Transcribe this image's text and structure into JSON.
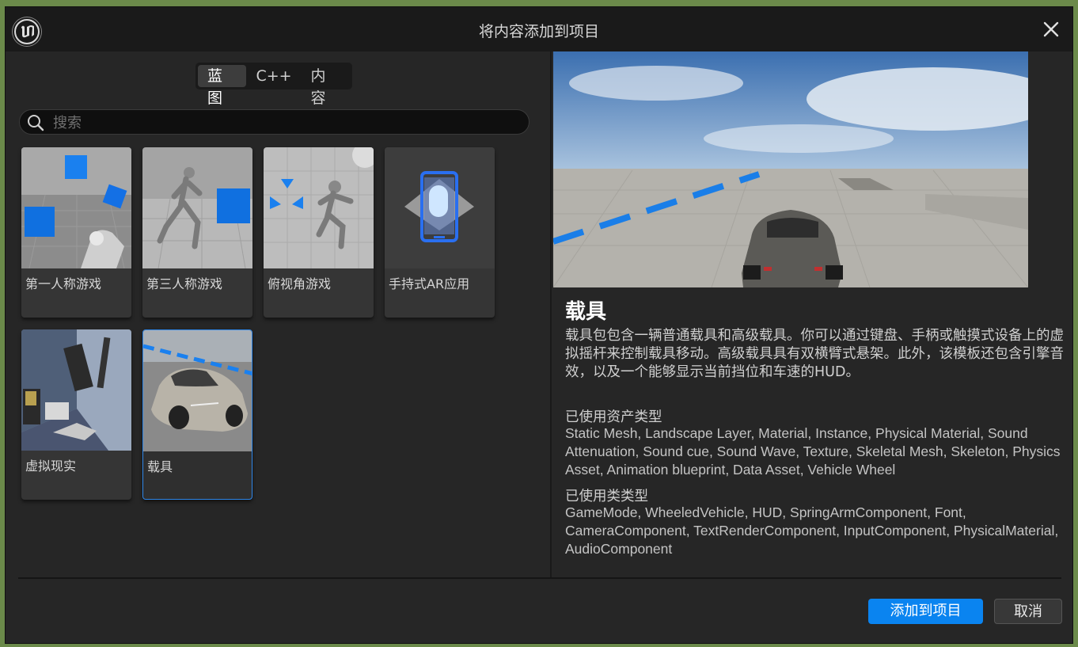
{
  "window": {
    "title": "将内容添加到项目"
  },
  "tabs": [
    {
      "label": "蓝图",
      "active": true
    },
    {
      "label": "C++",
      "active": false
    },
    {
      "label": "内容",
      "active": false
    }
  ],
  "search": {
    "placeholder": "搜索",
    "value": ""
  },
  "templates": [
    {
      "label": "第一人称游戏",
      "thumb": "first-person-thumbnail"
    },
    {
      "label": "第三人称游戏",
      "thumb": "third-person-thumbnail"
    },
    {
      "label": "俯视角游戏",
      "thumb": "top-down-thumbnail"
    },
    {
      "label": "手持式AR应用",
      "thumb": "handheld-ar-thumbnail"
    },
    {
      "label": "虚拟现实",
      "thumb": "virtual-reality-thumbnail"
    },
    {
      "label": "载具",
      "thumb": "vehicle-thumbnail",
      "selected": true
    }
  ],
  "details": {
    "title": "载具",
    "description": "载具包包含一辆普通载具和高级载具。你可以通过键盘、手柄或触摸式设备上的虚拟摇杆来控制载具移动。高级载具具有双横臂式悬架。此外，该模板还包含引擎音效，以及一个能够显示当前挡位和车速的HUD。",
    "assets_heading": "已使用资产类型",
    "assets": "Static Mesh, Landscape Layer, Material, Instance, Physical Material, Sound Attenuation, Sound cue, Sound Wave, Texture, Skeletal Mesh, Skeleton, Physics Asset, Animation blueprint, Data Asset, Vehicle Wheel",
    "classes_heading": "已使用类类型",
    "classes": "GameMode, WheeledVehicle, HUD, SpringArmComponent, Font, CameraComponent, TextRenderComponent, InputComponent, PhysicalMaterial, AudioComponent"
  },
  "buttons": {
    "add": "添加到项目",
    "cancel": "取消"
  },
  "colors": {
    "accent": "#0a84f0",
    "background": "#262626",
    "titlebar": "#1a1a1a"
  }
}
